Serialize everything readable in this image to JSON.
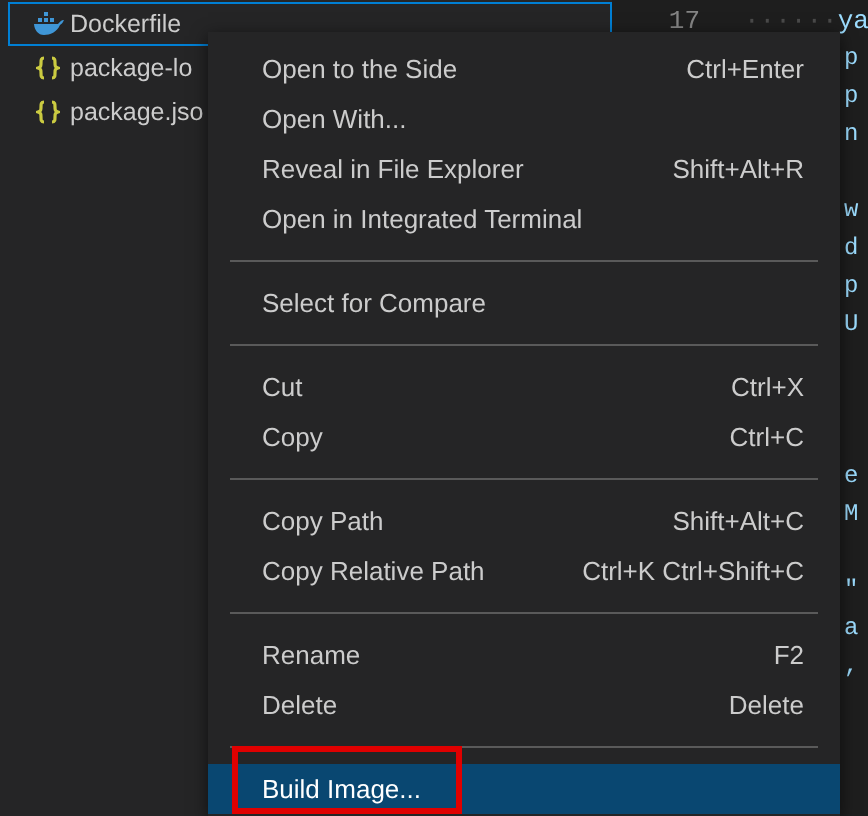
{
  "explorer": {
    "files": [
      {
        "name": "Dockerfile",
        "kind": "docker",
        "selected": true
      },
      {
        "name": "package-lo",
        "kind": "json",
        "selected": false
      },
      {
        "name": "package.jso",
        "kind": "json",
        "selected": false
      }
    ]
  },
  "editor": {
    "line_number": "17",
    "indent": "······",
    "lines": [
      {
        "kind": "code",
        "text": "ya"
      },
      {
        "kind": "code",
        "text": "p"
      },
      {
        "kind": "code",
        "text": "p"
      },
      {
        "kind": "code",
        "text": "n"
      },
      {
        "kind": "blank"
      },
      {
        "kind": "code",
        "text": "w"
      },
      {
        "kind": "code",
        "text": "d"
      },
      {
        "kind": "code",
        "text": "p"
      },
      {
        "kind": "code",
        "text": "U"
      },
      {
        "kind": "blank"
      },
      {
        "kind": "blank"
      },
      {
        "kind": "blank"
      },
      {
        "kind": "code",
        "text": "e"
      },
      {
        "kind": "code",
        "text": "M"
      },
      {
        "kind": "blank"
      },
      {
        "kind": "code",
        "text": "\""
      },
      {
        "kind": "code",
        "text": "a"
      },
      {
        "kind": "code",
        "text": ","
      }
    ]
  },
  "context_menu": {
    "items": [
      {
        "kind": "item",
        "label": "Open to the Side",
        "shortcut": "Ctrl+Enter",
        "selected": false
      },
      {
        "kind": "item",
        "label": "Open With...",
        "selected": false
      },
      {
        "kind": "item",
        "label": "Reveal in File Explorer",
        "shortcut": "Shift+Alt+R",
        "selected": false
      },
      {
        "kind": "item",
        "label": "Open in Integrated Terminal",
        "selected": false
      },
      {
        "kind": "separator"
      },
      {
        "kind": "item",
        "label": "Select for Compare",
        "selected": false
      },
      {
        "kind": "separator"
      },
      {
        "kind": "item",
        "label": "Cut",
        "shortcut": "Ctrl+X",
        "selected": false
      },
      {
        "kind": "item",
        "label": "Copy",
        "shortcut": "Ctrl+C",
        "selected": false
      },
      {
        "kind": "separator"
      },
      {
        "kind": "item",
        "label": "Copy Path",
        "shortcut": "Shift+Alt+C",
        "selected": false
      },
      {
        "kind": "item",
        "label": "Copy Relative Path",
        "shortcut": "Ctrl+K Ctrl+Shift+C",
        "selected": false
      },
      {
        "kind": "separator"
      },
      {
        "kind": "item",
        "label": "Rename",
        "shortcut": "F2",
        "selected": false
      },
      {
        "kind": "item",
        "label": "Delete",
        "shortcut": "Delete",
        "selected": false
      },
      {
        "kind": "separator"
      },
      {
        "kind": "item",
        "label": "Build Image...",
        "selected": true,
        "highlighted_box": true
      }
    ]
  }
}
